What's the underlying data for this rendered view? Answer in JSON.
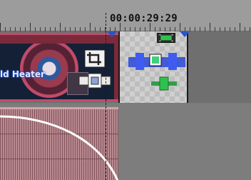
{
  "ruler": {
    "timecode": "00:00:29:29"
  },
  "video_track": {
    "main_clip": {
      "thumbnail_text": "ld Heater",
      "crop_icon": "crop-icon",
      "pan_icon": "pan-crop-icon"
    },
    "transition_clip": {
      "badge_icon": "film-icon",
      "effect_icon": "transition-effect-icon",
      "pan_icon": "pan-crop-icon"
    }
  },
  "audio_track": {
    "clip": {
      "icon": "audio-waveform"
    }
  },
  "colors": {
    "accent_blue": "#2a55c8",
    "clip_border": "#c24b6a",
    "audio_fill": "#b88a90",
    "timeline_bg": "#7b7b7b"
  }
}
